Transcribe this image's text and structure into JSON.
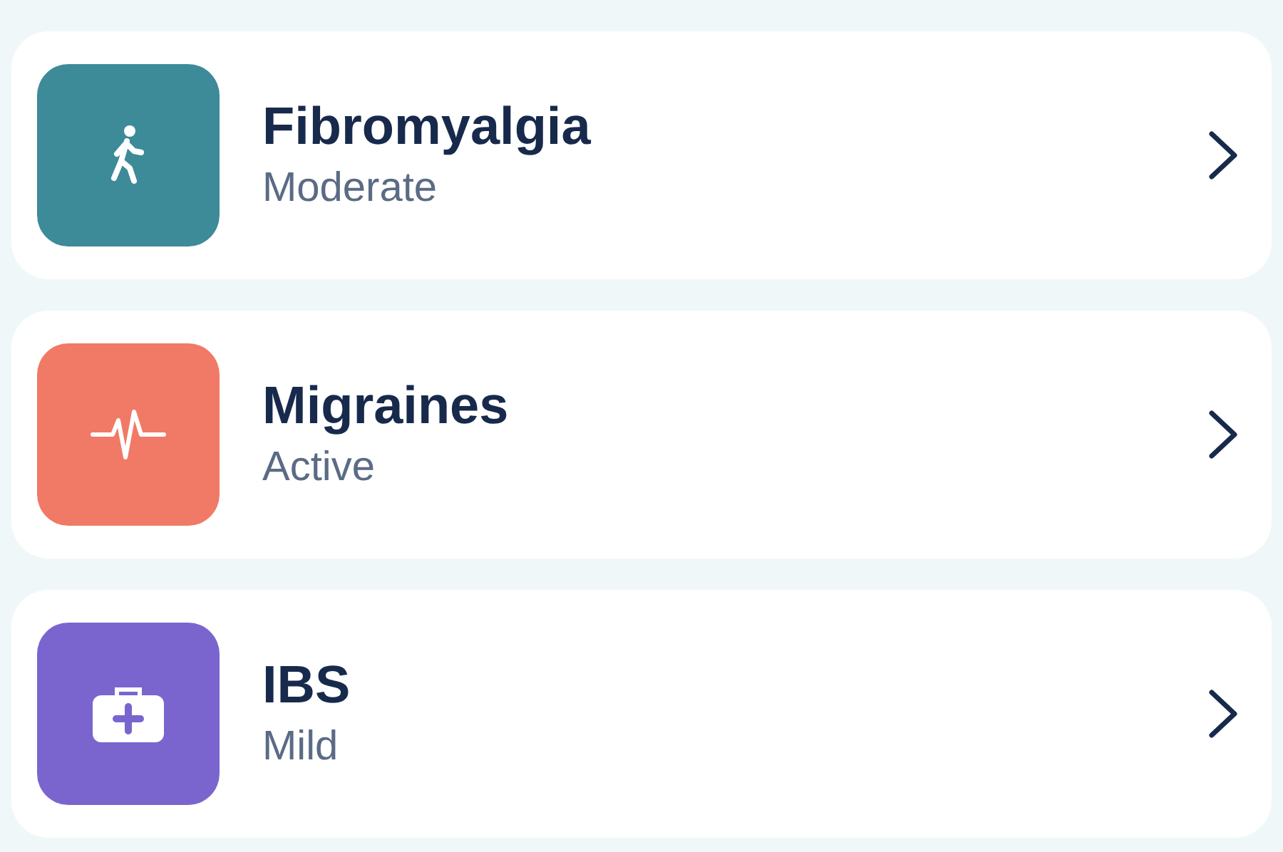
{
  "conditions": [
    {
      "name": "Fibromyalgia",
      "status": "Moderate",
      "color": "#3d8a99"
    },
    {
      "name": "Migraines",
      "status": "Active",
      "color": "#f07a66"
    },
    {
      "name": "IBS",
      "status": "Mild",
      "color": "#7a65cf"
    }
  ]
}
